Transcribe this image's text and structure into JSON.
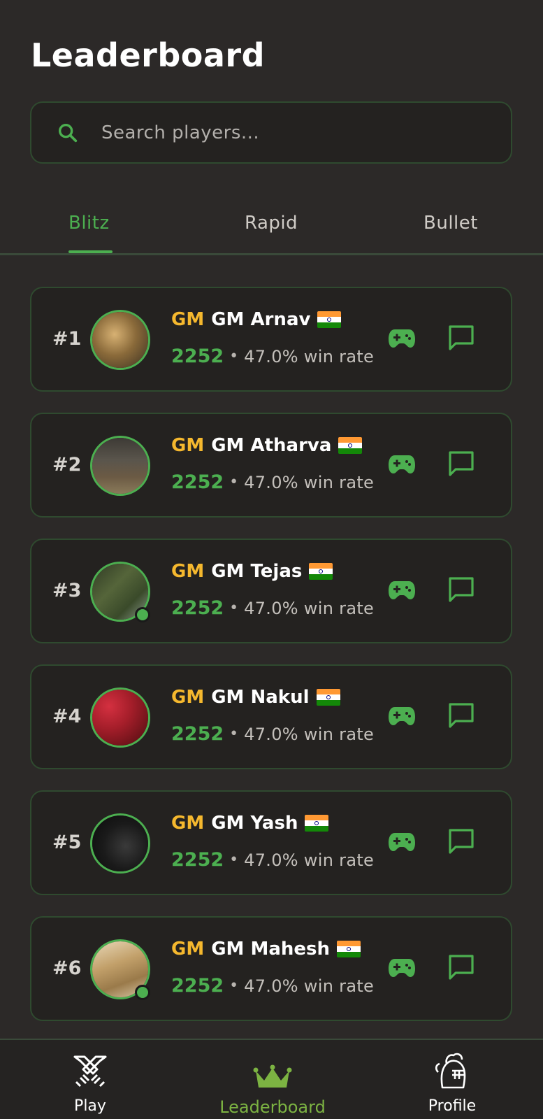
{
  "page": {
    "title": "Leaderboard"
  },
  "search": {
    "placeholder": "Search players..."
  },
  "tabs": [
    {
      "label": "Blitz",
      "active": true
    },
    {
      "label": "Rapid",
      "active": false
    },
    {
      "label": "Bullet",
      "active": false
    }
  ],
  "players": [
    {
      "rank": "#1",
      "title": "GM",
      "name": "GM Arnav",
      "rating": "2252",
      "separator": "•",
      "win_rate": "47.0% win rate",
      "online": false,
      "avatar": "lattice-photo"
    },
    {
      "rank": "#2",
      "title": "GM",
      "name": "GM Atharva",
      "rating": "2252",
      "separator": "•",
      "win_rate": "47.0% win rate",
      "online": false,
      "avatar": "room-photo"
    },
    {
      "rank": "#3",
      "title": "GM",
      "name": "GM Tejas",
      "rating": "2252",
      "separator": "•",
      "win_rate": "47.0% win rate",
      "online": true,
      "avatar": "forest-photo"
    },
    {
      "rank": "#4",
      "title": "GM",
      "name": "GM Nakul",
      "rating": "2252",
      "separator": "•",
      "win_rate": "47.0% win rate",
      "online": false,
      "avatar": "strawberries-photo"
    },
    {
      "rank": "#5",
      "title": "GM",
      "name": "GM Yash",
      "rating": "2252",
      "separator": "•",
      "win_rate": "47.0% win rate",
      "online": false,
      "avatar": "dark-photo"
    },
    {
      "rank": "#6",
      "title": "GM",
      "name": "GM Mahesh",
      "rating": "2252",
      "separator": "•",
      "win_rate": "47.0% win rate",
      "online": true,
      "avatar": "wood-photo"
    }
  ],
  "nav": [
    {
      "label": "Play",
      "icon": "crossed-swords-icon",
      "active": false
    },
    {
      "label": "Leaderboard",
      "icon": "crown-icon",
      "active": true
    },
    {
      "label": "Profile",
      "icon": "knight-helmet-icon",
      "active": false
    }
  ],
  "colors": {
    "accent": "#4caf50",
    "title_gold": "#f5b82e",
    "background": "#2c2928",
    "card": "#242220",
    "nav_active": "#7cb342"
  }
}
